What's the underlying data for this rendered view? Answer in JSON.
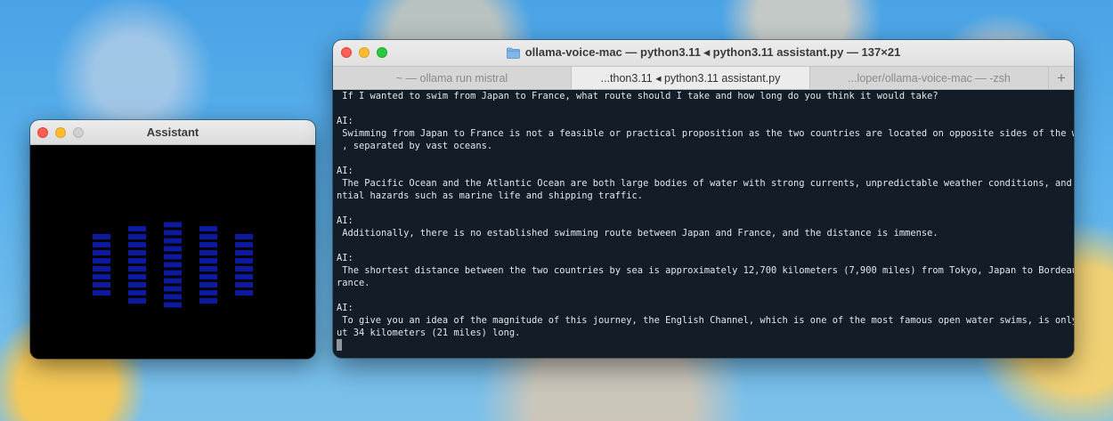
{
  "assistant_window": {
    "title": "Assistant",
    "visualizer": {
      "bar_color": "#0b1a9e",
      "segment_counts": [
        8,
        10,
        11,
        10,
        8
      ]
    }
  },
  "terminal_window": {
    "title": "ollama-voice-mac — python3.11 ◂ python3.11 assistant.py — 137×21",
    "tabs": [
      {
        "label": "~ — ollama run mistral",
        "active": false
      },
      {
        "label": "...thon3.11 ◂ python3.11 assistant.py",
        "active": true
      },
      {
        "label": "...loper/ollama-voice-mac — -zsh",
        "active": false
      }
    ],
    "add_tab_label": "+",
    "lines": [
      " If I wanted to swim from Japan to France, what route should I take and how long do you think it would take?",
      "",
      "AI:",
      " Swimming from Japan to France is not a feasible or practical proposition as the two countries are located on opposite sides of the world",
      " , separated by vast oceans.",
      "",
      "AI:",
      " The Pacific Ocean and the Atlantic Ocean are both large bodies of water with strong currents, unpredictable weather conditions, and pote",
      "ntial hazards such as marine life and shipping traffic.",
      "",
      "AI:",
      " Additionally, there is no established swimming route between Japan and France, and the distance is immense.",
      "",
      "AI:",
      " The shortest distance between the two countries by sea is approximately 12,700 kilometers (7,900 miles) from Tokyo, Japan to Bordeaux, F",
      "rance.",
      "",
      "AI:",
      " To give you an idea of the magnitude of this journey, the English Channel, which is one of the most famous open water swims, is only abo",
      "ut 34 kilometers (21 miles) long."
    ]
  }
}
